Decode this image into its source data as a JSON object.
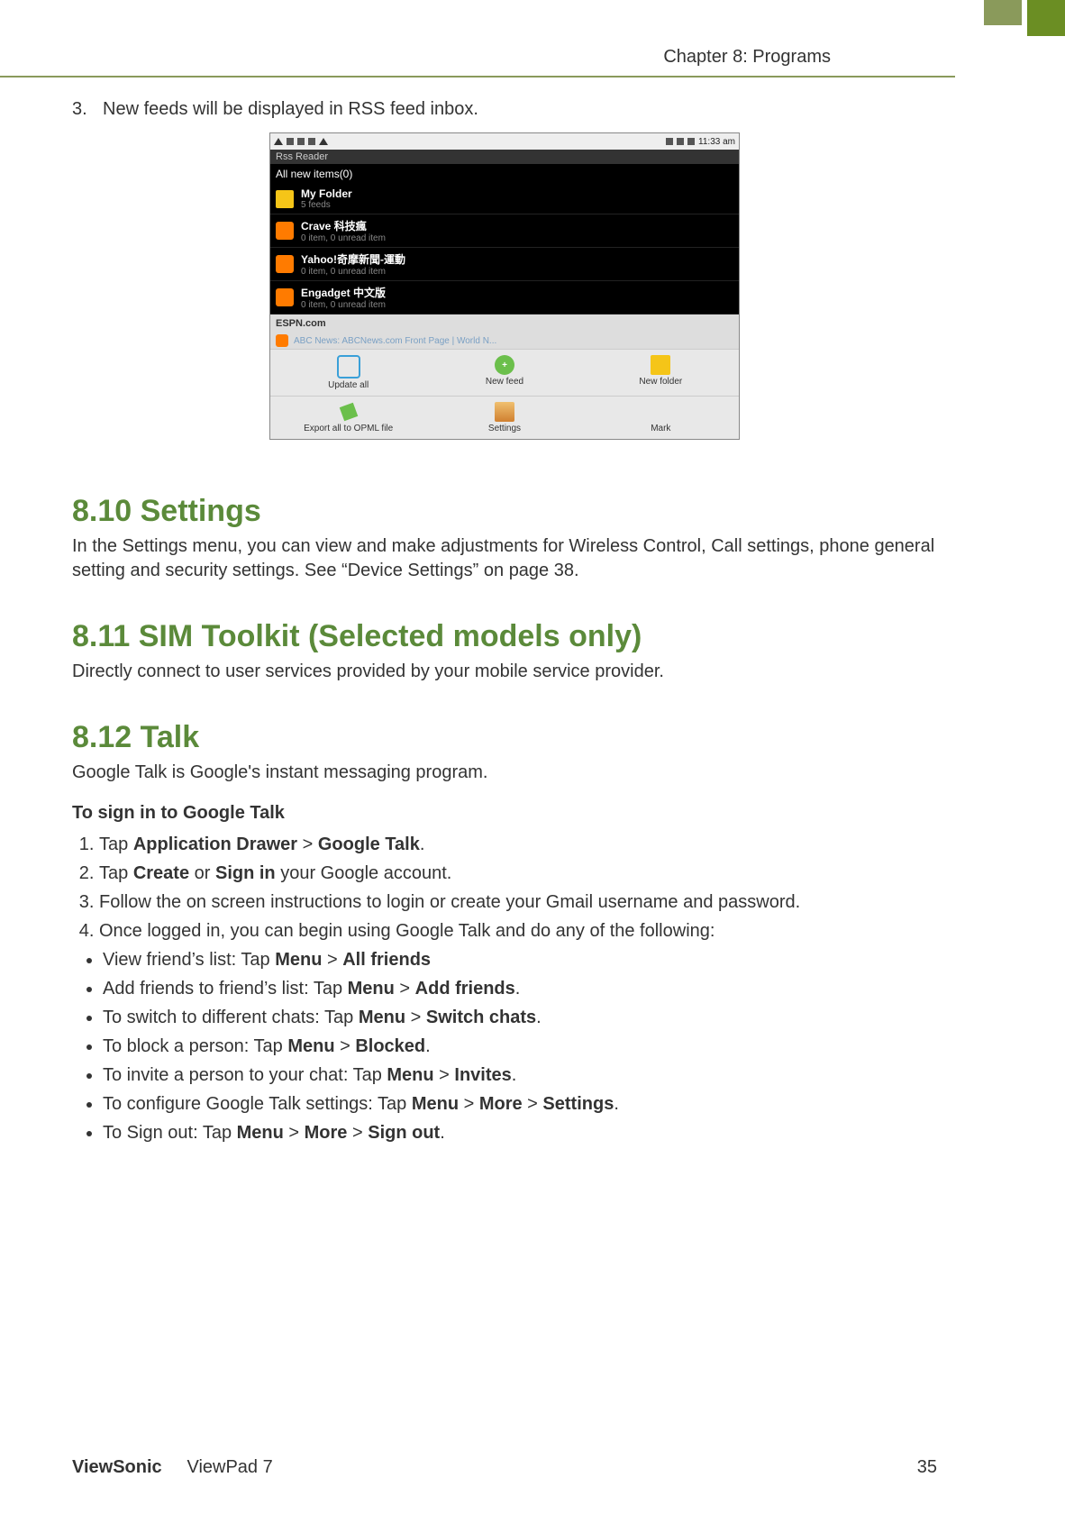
{
  "header": {
    "chapter": "Chapter 8: Programs"
  },
  "item3": {
    "num": "3.",
    "text": "New feeds will be displayed in RSS feed inbox."
  },
  "shot": {
    "time": "11:33 am",
    "app_title": "Rss Reader",
    "subtitle": "All new items(0)",
    "rows": [
      {
        "icon": "folder",
        "name": "My Folder",
        "sub": "5 feeds"
      },
      {
        "icon": "rss",
        "name": "Crave 科技瘋",
        "sub": "0 item, 0 unread item"
      },
      {
        "icon": "rss",
        "name": "Yahoo!奇摩新聞-運動",
        "sub": "0 item, 0 unread item"
      },
      {
        "icon": "rss",
        "name": "Engadget 中文版",
        "sub": "0 item, 0 unread item"
      }
    ],
    "last_row": "ESPN.com",
    "faint": "ABC News: ABCNews.com Front Page | World N...",
    "toolbar": {
      "update": "Update all",
      "newfeed": "New feed",
      "newfolder": "New folder",
      "export": "Export all to OPML file",
      "settings": "Settings",
      "mark": "Mark"
    }
  },
  "s810": {
    "title": "8.10 Settings",
    "body": "In the Settings menu, you can view and make adjustments for Wireless Control, Call settings, phone general setting and security settings. See “Device Settings” on page 38."
  },
  "s811": {
    "title": "8.11 SIM Toolkit (Selected models only)",
    "body": "Directly connect to user services provided by your mobile service provider."
  },
  "s812": {
    "title": "8.12 Talk",
    "body": "Google Talk is Google's instant messaging program.",
    "subhead": "To sign in to Google Talk",
    "step1_a": "Tap ",
    "step1_b": "Application Drawer",
    "step1_c": " > ",
    "step1_d": "Google Talk",
    "step1_e": ".",
    "step2_a": "Tap ",
    "step2_b": "Create",
    "step2_c": " or ",
    "step2_d": "Sign in",
    "step2_e": " your Google account.",
    "step3": "Follow the on screen instructions to login or create your Gmail username and password.",
    "step4": "Once logged in, you can begin using Google Talk and do any of the following:",
    "b1_a": "View friend’s list: Tap ",
    "b1_b": "Menu",
    "b1_c": " > ",
    "b1_d": "All friends",
    "b2_a": "Add friends to friend’s list: Tap ",
    "b2_b": "Menu",
    "b2_c": " > ",
    "b2_d": "Add friends",
    "b2_e": ".",
    "b3_a": "To switch to different chats: Tap ",
    "b3_b": "Menu",
    "b3_c": " > ",
    "b3_d": "Switch chats",
    "b3_e": ".",
    "b4_a": "To block a person: Tap ",
    "b4_b": "Menu",
    "b4_c": " > ",
    "b4_d": "Blocked",
    "b4_e": ".",
    "b5_a": "To invite a person to your chat: Tap ",
    "b5_b": "Menu",
    "b5_c": " > ",
    "b5_d": "Invites",
    "b5_e": ".",
    "b6_a": "To configure Google Talk settings: Tap ",
    "b6_b": "Menu",
    "b6_c": " > ",
    "b6_d": "More",
    "b6_e": " > ",
    "b6_f": "Settings",
    "b6_g": ".",
    "b7_a": "To Sign out: Tap ",
    "b7_b": "Menu",
    "b7_c": " > ",
    "b7_d": "More",
    "b7_e": " > ",
    "b7_f": "Sign out",
    "b7_g": "."
  },
  "footer": {
    "brand": "ViewSonic",
    "product": "ViewPad 7",
    "page": "35"
  }
}
